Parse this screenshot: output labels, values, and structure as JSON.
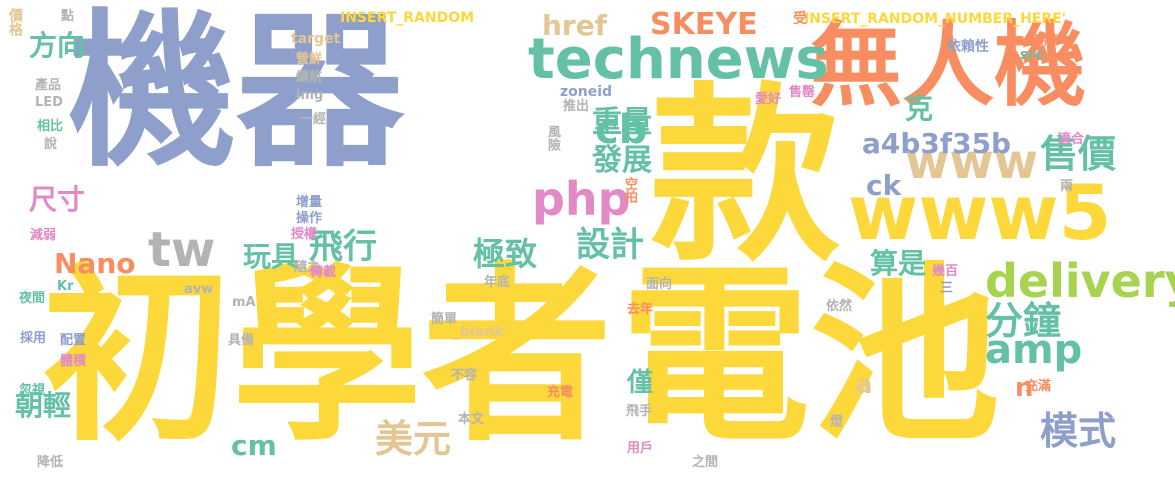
{
  "palette": {
    "blue": "#8f9fcb",
    "yellow": "#fcd83a",
    "orange": "#f98d62",
    "green": "#64c1a6",
    "lime": "#a8d34f",
    "tan": "#e4c594",
    "pink": "#e18ac5",
    "gray": "#b3b3b3"
  },
  "words": [
    {
      "text": "機器",
      "color": "blue"
    },
    {
      "text": "款",
      "color": "yellow"
    },
    {
      "text": "初學者",
      "color": "yellow"
    },
    {
      "text": "電池",
      "color": "yellow"
    },
    {
      "text": "無人機",
      "color": "orange"
    },
    {
      "text": "technews",
      "color": "green"
    },
    {
      "text": "www5",
      "color": "yellow"
    },
    {
      "text": "www",
      "color": "tan"
    },
    {
      "text": "delivery",
      "color": "lime"
    },
    {
      "text": "php",
      "color": "pink"
    },
    {
      "text": "tw",
      "color": "gray"
    },
    {
      "text": "amp",
      "color": "green"
    },
    {
      "text": "分鐘",
      "color": "green"
    },
    {
      "text": "售價",
      "color": "green"
    },
    {
      "text": "模式",
      "color": "blue"
    },
    {
      "text": "美元",
      "color": "tan"
    },
    {
      "text": "cb",
      "color": "green"
    },
    {
      "text": "飛行",
      "color": "green"
    },
    {
      "text": "設計",
      "color": "green"
    },
    {
      "text": "極致",
      "color": "green"
    },
    {
      "text": "發展",
      "color": "green"
    },
    {
      "text": "重量",
      "color": "green"
    },
    {
      "text": "SKEYE",
      "color": "orange"
    },
    {
      "text": "href",
      "color": "tan"
    },
    {
      "text": "方向",
      "color": "green"
    },
    {
      "text": "尺寸",
      "color": "pink"
    },
    {
      "text": "Nano",
      "color": "orange"
    },
    {
      "text": "玩具",
      "color": "green"
    },
    {
      "text": "朝輕",
      "color": "green"
    },
    {
      "text": "cm",
      "color": "green"
    },
    {
      "text": "a4b3f35b",
      "color": "blue"
    },
    {
      "text": "ck",
      "color": "blue"
    },
    {
      "text": "算是",
      "color": "green"
    },
    {
      "text": "克",
      "color": "green"
    },
    {
      "text": "僅",
      "color": "green"
    },
    {
      "text": "a",
      "color": "tan"
    },
    {
      "text": "n",
      "color": "orange"
    },
    {
      "text": "INSERT_RANDOM",
      "color": "yellow"
    },
    {
      "text": "INSERT_RANDOM_NUMBER_HERE'",
      "color": "yellow"
    },
    {
      "text": "target",
      "color": "tan"
    },
    {
      "text": "價格",
      "color": "tan"
    },
    {
      "text": "點",
      "color": "gray"
    },
    {
      "text": "受",
      "color": "orange"
    },
    {
      "text": "熟練",
      "color": "orange"
    },
    {
      "text": "依賴性",
      "color": "blue"
    },
    {
      "text": "營鮮",
      "color": "tan"
    },
    {
      "text": "續航",
      "color": "gray"
    },
    {
      "text": "img",
      "color": "gray"
    },
    {
      "text": "zoneid",
      "color": "blue"
    },
    {
      "text": "src",
      "color": "green"
    },
    {
      "text": "產品",
      "color": "gray"
    },
    {
      "text": "LED",
      "color": "gray"
    },
    {
      "text": "相比",
      "color": "green"
    },
    {
      "text": "說",
      "color": "gray"
    },
    {
      "text": "推出",
      "color": "gray"
    },
    {
      "text": "愛好",
      "color": "pink"
    },
    {
      "text": "售罄",
      "color": "pink"
    },
    {
      "text": "一經",
      "color": "gray"
    },
    {
      "text": "風險",
      "color": "gray"
    },
    {
      "text": "適合",
      "color": "pink"
    },
    {
      "text": "兩",
      "color": "gray"
    },
    {
      "text": "空拍",
      "color": "orange"
    },
    {
      "text": "增量",
      "color": "blue"
    },
    {
      "text": "操作",
      "color": "blue"
    },
    {
      "text": "授權",
      "color": "pink"
    },
    {
      "text": "減弱",
      "color": "pink"
    },
    {
      "text": "隨之",
      "color": "gray"
    },
    {
      "text": "轉載",
      "color": "pink"
    },
    {
      "text": "幾百",
      "color": "pink"
    },
    {
      "text": "三",
      "color": "blue"
    },
    {
      "text": "面向",
      "color": "gray"
    },
    {
      "text": "年底",
      "color": "gray"
    },
    {
      "text": "夜間",
      "color": "green"
    },
    {
      "text": "Kr",
      "color": "green"
    },
    {
      "text": "avw",
      "color": "gray"
    },
    {
      "text": "mA",
      "color": "gray"
    },
    {
      "text": "依然",
      "color": "gray"
    },
    {
      "text": "去年",
      "color": "orange"
    },
    {
      "text": "採用",
      "color": "blue"
    },
    {
      "text": "配置",
      "color": "blue"
    },
    {
      "text": "具備",
      "color": "gray"
    },
    {
      "text": "簡單",
      "color": "gray"
    },
    {
      "text": "_blank'",
      "color": "tan"
    },
    {
      "text": "體積",
      "color": "pink"
    },
    {
      "text": "不容",
      "color": "gray"
    },
    {
      "text": "充滿",
      "color": "orange"
    },
    {
      "text": "忽視",
      "color": "green"
    },
    {
      "text": "充電",
      "color": "orange"
    },
    {
      "text": "飛手",
      "color": "gray"
    },
    {
      "text": "本文",
      "color": "gray"
    },
    {
      "text": "燈",
      "color": "gray"
    },
    {
      "text": "降低",
      "color": "gray"
    },
    {
      "text": "用戶",
      "color": "pink"
    },
    {
      "text": "之間",
      "color": "gray"
    }
  ]
}
